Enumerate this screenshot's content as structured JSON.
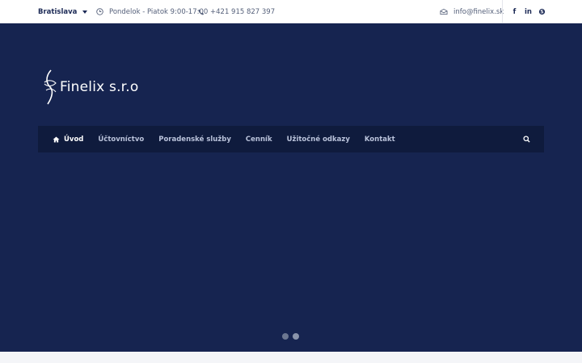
{
  "topbar": {
    "city": "Bratislava",
    "hours": "Pondelok - Piatok 9:00-17:00",
    "phone": "+421 915 827 397",
    "email": "info@finelix.sk",
    "socials": [
      {
        "icon": "facebook-icon",
        "glyph": "f"
      },
      {
        "icon": "linkedin-icon",
        "glyph": "in"
      },
      {
        "icon": "skype-icon",
        "glyph": "S"
      }
    ]
  },
  "brand": {
    "name": "Finelix s.r.o"
  },
  "nav": {
    "items": [
      {
        "label": "Úvod",
        "active": true
      },
      {
        "label": "Účtovníctvo",
        "active": false
      },
      {
        "label": "Poradenské služby",
        "active": false
      },
      {
        "label": "Cenník",
        "active": false
      },
      {
        "label": "Užitočné odkazy",
        "active": false
      },
      {
        "label": "Kontakt",
        "active": false
      }
    ]
  },
  "slider": {
    "slide_count": 2,
    "active_index": 1
  },
  "colors": {
    "hero_bg": "#162450",
    "nav_bg": "#0f1b3d",
    "topbar_bg": "#ffffff",
    "accent_dark": "#1c2a56"
  }
}
